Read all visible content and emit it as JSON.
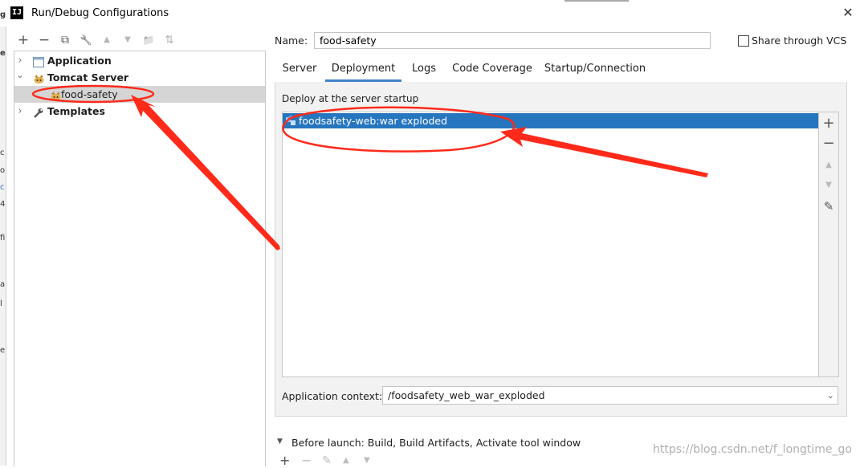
{
  "window": {
    "icon_text": "IJ",
    "title": "Run/Debug Configurations",
    "close_glyph": "✕"
  },
  "background_window_glyphs": [
    "g",
    "e",
    "c",
    "o",
    "c",
    "4",
    "fi",
    "a",
    "l",
    "e"
  ],
  "left_toolbar": [
    {
      "name": "add-icon",
      "glyph": "+",
      "enabled": true
    },
    {
      "name": "remove-icon",
      "glyph": "−",
      "enabled": true
    },
    {
      "name": "copy-icon",
      "glyph": "⧉",
      "enabled": true
    },
    {
      "name": "wrench-icon",
      "glyph": "🔧",
      "enabled": true
    },
    {
      "name": "move-up-icon",
      "glyph": "▲",
      "enabled": false
    },
    {
      "name": "move-down-icon",
      "glyph": "▼",
      "enabled": false
    },
    {
      "name": "folder-icon",
      "glyph": "📁",
      "enabled": true
    },
    {
      "name": "sort-icon",
      "glyph": "⇅",
      "enabled": false
    }
  ],
  "tree": [
    {
      "label": "Application",
      "bold": true,
      "icon": "application-icon",
      "expander": "›",
      "level": 0
    },
    {
      "label": "Tomcat Server",
      "bold": true,
      "icon": "tomcat-icon",
      "expander": "⌄",
      "level": 0
    },
    {
      "label": "food-safety",
      "bold": false,
      "icon": "tomcat-icon",
      "expander": "",
      "level": 1,
      "selected": true
    },
    {
      "label": "Templates",
      "bold": true,
      "icon": "wrench-icon",
      "expander": "›",
      "level": 0
    }
  ],
  "name_field": {
    "label": "Name:",
    "value": "food-safety"
  },
  "share": {
    "label": "Share through VCS",
    "checked": false
  },
  "tabs": [
    {
      "label": "Server",
      "active": false
    },
    {
      "label": "Deployment",
      "active": true
    },
    {
      "label": "Logs",
      "active": false
    },
    {
      "label": "Code Coverage",
      "active": false
    },
    {
      "label": "Startup/Connection",
      "active": false
    }
  ],
  "deployment": {
    "caption": "Deploy at the server startup",
    "artifacts": [
      "foodsafety-web:war exploded"
    ],
    "side_toolbar": [
      {
        "name": "add-icon",
        "glyph": "+",
        "enabled": true
      },
      {
        "name": "remove-icon",
        "glyph": "−",
        "enabled": true
      },
      {
        "name": "move-up-icon",
        "glyph": "▲",
        "enabled": false
      },
      {
        "name": "move-down-icon",
        "glyph": "▼",
        "enabled": false
      },
      {
        "name": "edit-icon",
        "glyph": "✎",
        "enabled": true
      }
    ]
  },
  "application_context": {
    "label": "Application context:",
    "value": "/foodsafety_web_war_exploded",
    "dropdown_glyph": "⌄"
  },
  "before_launch": {
    "arrow": "▼",
    "text": "Before launch: Build, Build Artifacts, Activate tool window",
    "toolbar": [
      {
        "name": "add-icon",
        "glyph": "+",
        "enabled": true
      },
      {
        "name": "remove-icon",
        "glyph": "−",
        "enabled": false
      },
      {
        "name": "edit-icon",
        "glyph": "✎",
        "enabled": false
      },
      {
        "name": "move-up-icon",
        "glyph": "▲",
        "enabled": false
      },
      {
        "name": "move-down-icon",
        "glyph": "▼",
        "enabled": false
      }
    ]
  },
  "watermark": "https://blog.csdn.net/f_longtime_go",
  "colors": {
    "selection": "#2675bf",
    "tree_selection": "#d5d5d5",
    "annotation": "#ff2a1a",
    "active_tab": "#4083c9"
  }
}
